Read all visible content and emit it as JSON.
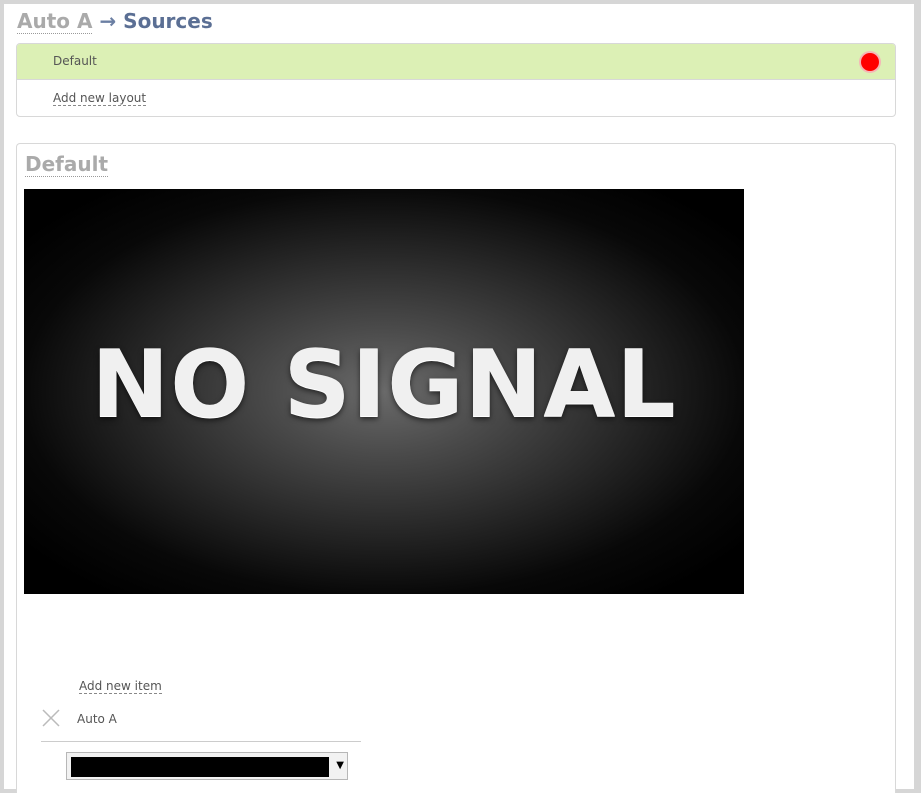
{
  "breadcrumb": {
    "parent": "Auto A",
    "separator": "→",
    "current": "Sources"
  },
  "layouts": {
    "items": [
      {
        "label": "Default",
        "active": true,
        "status": "live"
      }
    ],
    "add_label": "Add new layout",
    "status_color": "#ff0000",
    "active_color": "#dcf0b5"
  },
  "layout": {
    "title": "Default",
    "preview_text": "NO SIGNAL",
    "add_item_label": "Add new item",
    "sources": [
      {
        "label": "Auto A"
      }
    ],
    "source_select_value": ""
  }
}
